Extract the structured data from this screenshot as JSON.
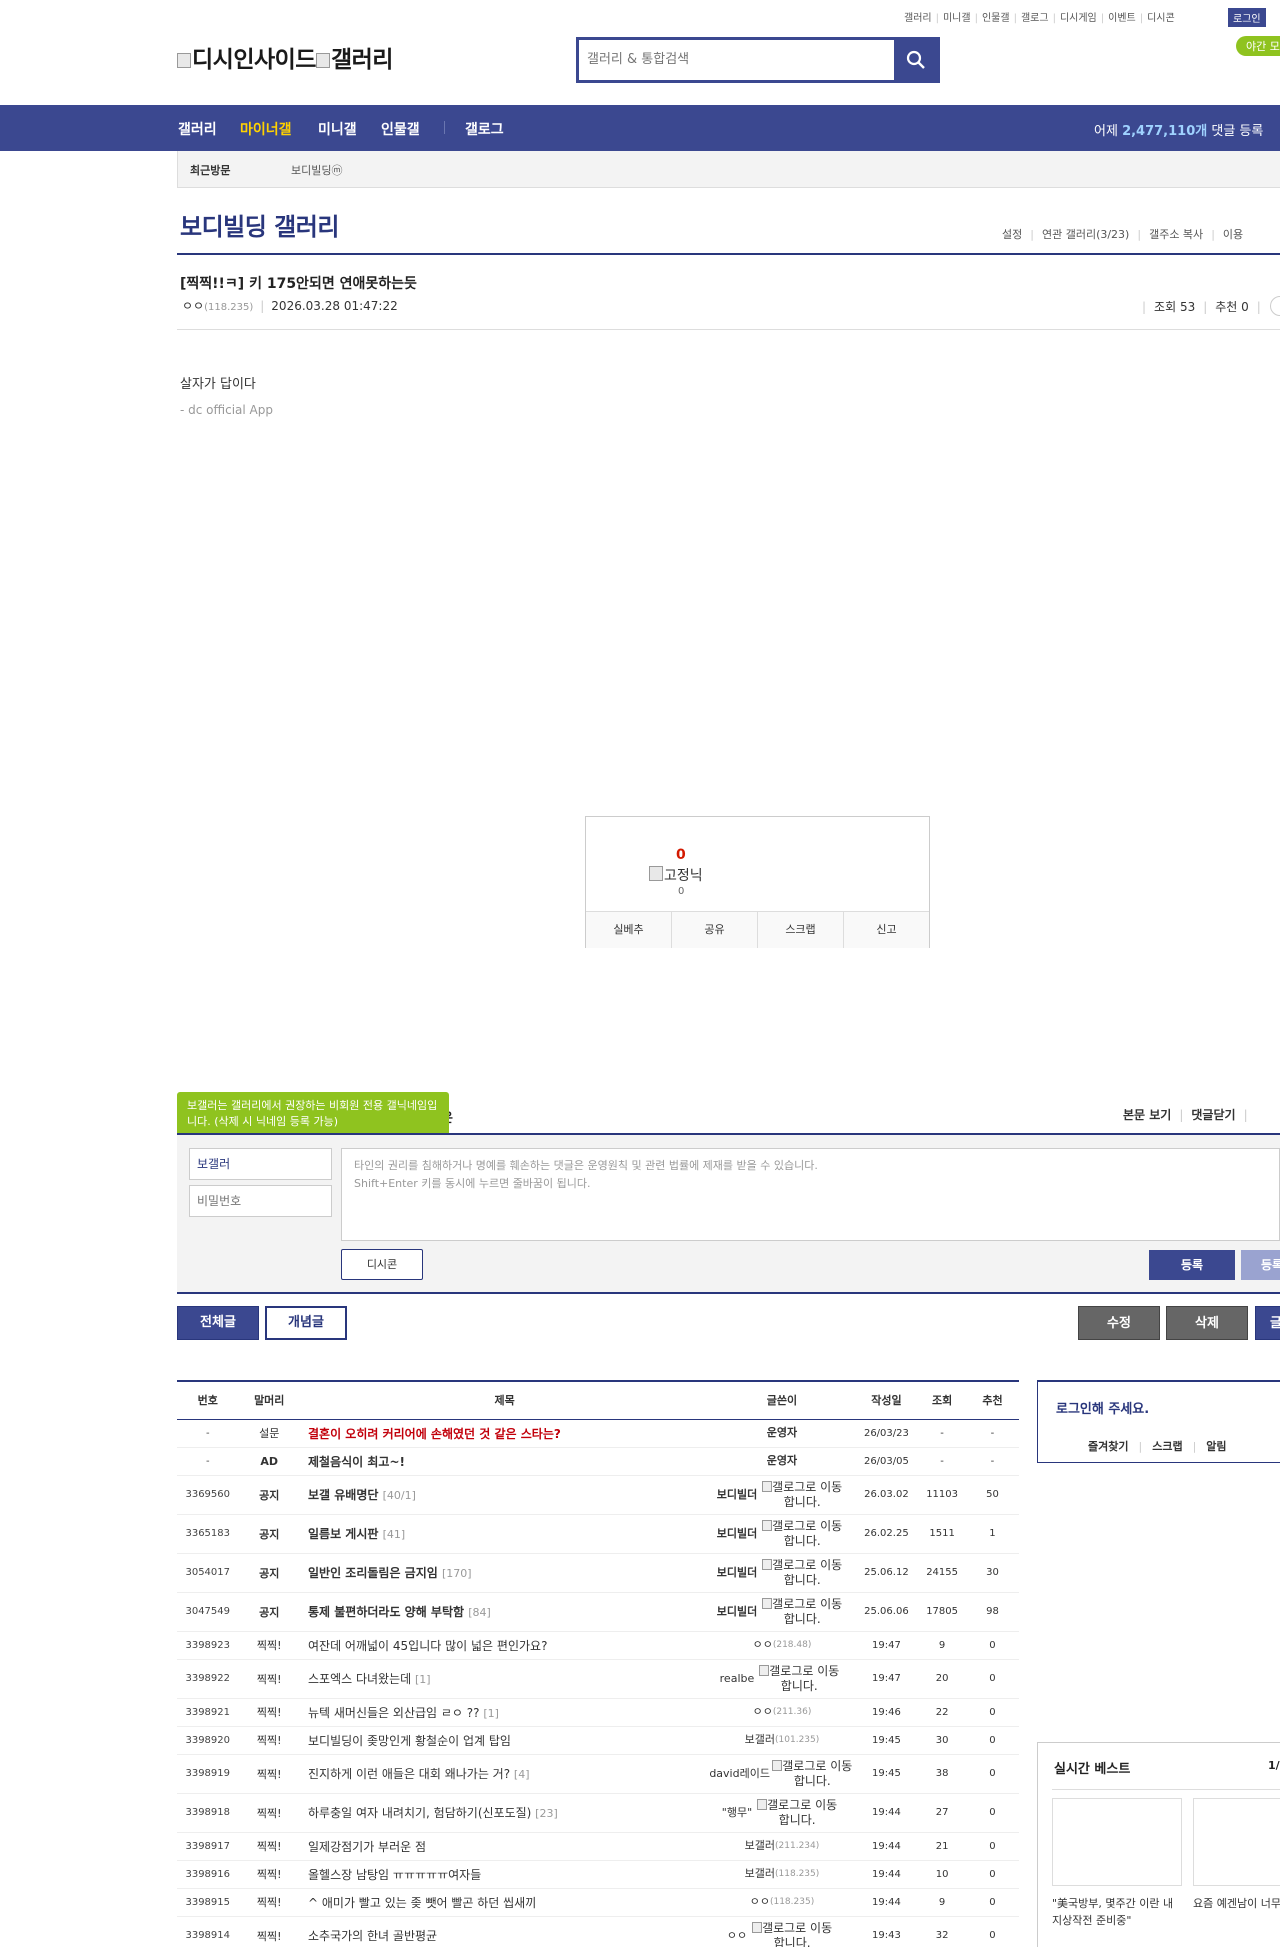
{
  "header": {
    "topnav": [
      "갤러리",
      "미니갤",
      "인물갤",
      "갤로그",
      "디시게임",
      "이벤트",
      "디시콘"
    ],
    "login": "로그인",
    "night_mode": "야간 모",
    "logo_text": "디시인사이드",
    "logo_sub": "갤러리",
    "search_placeholder": "갤러리 & 통합검색"
  },
  "gnb": {
    "items": [
      "갤러리",
      "마이너갤",
      "미니갤",
      "인물갤",
      "갤로그"
    ],
    "active_index": 1,
    "stat_prefix": "어제",
    "stat_num": "2,477,110개",
    "stat_suffix": "댓글 등록"
  },
  "recent": {
    "label": "최근방문",
    "item": "보디빌딩ⓜ"
  },
  "gallery": {
    "title": "보디빌딩 갤러리",
    "links": [
      "설정",
      "연관 갤러리(3/23)",
      "갤주소 복사",
      "이용"
    ]
  },
  "post": {
    "title": "[찍찍!!ㅋ] 키 175안되면 연애못하는듯",
    "writer": "ㅇㅇ",
    "ip": "(118.235)",
    "date": "2026.03.28 01:47:22",
    "views_label": "조회 53",
    "recommend_label": "추천 0",
    "body": "살자가 답이다",
    "signature": "- dc official App"
  },
  "recommend": {
    "count": "0",
    "fixed_nick_alt": "고정닉",
    "fixed_count": "0",
    "actions": [
      "실베추",
      "공유",
      "스크랩",
      "신고"
    ]
  },
  "comment": {
    "tooltip": "보갤러는 갤러리에서 권장하는 비회원 전용 갤닉네임입니다. (삭제 시 닉네임 등록 가능)",
    "tooltip_tail": "은",
    "view_body": "본문 보기",
    "close_comments": "댓글닫기",
    "nick_value": "보갤러",
    "password_placeholder": "비밀번호",
    "text_placeholder_1": "타인의 권리를 침해하거나 명예를 훼손하는 댓글은 운영원칙 및 관련 법률에 제재를 받을 수 있습니다.",
    "text_placeholder_2": "Shift+Enter 키를 동시에 누르면 줄바꿈이 됩니다.",
    "dccon": "디시콘",
    "submit": "등록",
    "submit2": "등록"
  },
  "buttons": {
    "tab_all": "전체글",
    "tab_concept": "개념글",
    "edit": "수정",
    "delete": "삭제",
    "write": "글"
  },
  "list": {
    "headers": [
      "번호",
      "말머리",
      "제목",
      "글쓴이",
      "작성일",
      "조회",
      "추천"
    ],
    "rows": [
      {
        "no": "-",
        "head": "설문",
        "subject": "결혼이 오히려 커리어에 손해였던 것 같은 스타는?",
        "reply": "",
        "writer": "운영자",
        "ip": "",
        "gallog": "",
        "date": "26/03/23",
        "views": "-",
        "rec": "-",
        "type": "survey"
      },
      {
        "no": "-",
        "head": "AD",
        "subject": "제철음식이 최고~!",
        "reply": "",
        "writer": "운영자",
        "ip": "",
        "gallog": "",
        "date": "26/03/05",
        "views": "-",
        "rec": "-",
        "type": "notice"
      },
      {
        "no": "3369560",
        "head": "공지",
        "subject": "보갤 유배명단",
        "reply": "[40/1]",
        "writer": "보디빌더",
        "ip": "",
        "gallog": "갤로그로 이동합니다.",
        "date": "26.03.02",
        "views": "11103",
        "rec": "50",
        "type": "notice"
      },
      {
        "no": "3365183",
        "head": "공지",
        "subject": "일름보 게시판",
        "reply": "[41]",
        "writer": "보디빌더",
        "ip": "",
        "gallog": "갤로그로 이동합니다.",
        "date": "26.02.25",
        "views": "1511",
        "rec": "1",
        "type": "notice"
      },
      {
        "no": "3054017",
        "head": "공지",
        "subject": "일반인 조리돌림은 금지임",
        "reply": "[170]",
        "writer": "보디빌더",
        "ip": "",
        "gallog": "갤로그로 이동합니다.",
        "date": "25.06.12",
        "views": "24155",
        "rec": "30",
        "type": "notice"
      },
      {
        "no": "3047549",
        "head": "공지",
        "subject": "통제 불편하더라도 양해 부탁함",
        "reply": "[84]",
        "writer": "보디빌더",
        "ip": "",
        "gallog": "갤로그로 이동합니다.",
        "date": "25.06.06",
        "views": "17805",
        "rec": "98",
        "type": "notice"
      },
      {
        "no": "3398923",
        "head": "찍찍!",
        "subject": "여잔데 어깨넓이 45입니다 많이 넓은 편인가요?",
        "reply": "",
        "writer": "ㅇㅇ",
        "ip": "(218.48)",
        "gallog": "",
        "date": "19:47",
        "views": "9",
        "rec": "0",
        "type": "normal"
      },
      {
        "no": "3398922",
        "head": "찍찍!",
        "subject": "스포엑스 다녀왔는데",
        "reply": "[1]",
        "writer": "realbe",
        "ip": "",
        "gallog": "갤로그로 이동합니다.",
        "date": "19:47",
        "views": "20",
        "rec": "0",
        "type": "normal"
      },
      {
        "no": "3398921",
        "head": "찍찍!",
        "subject": "뉴텍 새머신들은 외산급임 ㄹㅇ ??",
        "reply": "[1]",
        "writer": "ㅇㅇ",
        "ip": "(211.36)",
        "gallog": "",
        "date": "19:46",
        "views": "22",
        "rec": "0",
        "type": "normal"
      },
      {
        "no": "3398920",
        "head": "찍찍!",
        "subject": "보디빌딩이 좆망인게 황철순이 업계 탑임",
        "reply": "",
        "writer": "보갤러",
        "ip": "(101.235)",
        "gallog": "",
        "date": "19:45",
        "views": "30",
        "rec": "0",
        "type": "normal"
      },
      {
        "no": "3398919",
        "head": "찍찍!",
        "subject": "진지하게 이런 애들은 대회 왜나가는 거?",
        "reply": "[4]",
        "writer": "david레이드",
        "ip": "",
        "gallog": "갤로그로 이동합니다.",
        "date": "19:45",
        "views": "38",
        "rec": "0",
        "type": "normal"
      },
      {
        "no": "3398918",
        "head": "찍찍!",
        "subject": "하루충일 여자 내려치기, 험담하기(신포도질)",
        "reply": "[23]",
        "writer": "\"행무\"",
        "ip": "",
        "gallog": "갤로그로 이동합니다.",
        "date": "19:44",
        "views": "27",
        "rec": "0",
        "type": "normal"
      },
      {
        "no": "3398917",
        "head": "찍찍!",
        "subject": "일제강점기가 부러운 점",
        "reply": "",
        "writer": "보갤러",
        "ip": "(211.234)",
        "gallog": "",
        "date": "19:44",
        "views": "21",
        "rec": "0",
        "type": "normal"
      },
      {
        "no": "3398916",
        "head": "찍찍!",
        "subject": "올헬스장 남탕임 ㅠㅠㅠㅠㅠ여자들",
        "reply": "",
        "writer": "보갤러",
        "ip": "(118.235)",
        "gallog": "",
        "date": "19:44",
        "views": "10",
        "rec": "0",
        "type": "normal"
      },
      {
        "no": "3398915",
        "head": "찍찍!",
        "subject": "^ 애미가 빨고 있는 좆 뺏어 빨곤 하던 씹새끼",
        "reply": "",
        "writer": "ㅇㅇ",
        "ip": "(118.235)",
        "gallog": "",
        "date": "19:44",
        "views": "9",
        "rec": "0",
        "type": "normal"
      },
      {
        "no": "3398914",
        "head": "찍찍!",
        "subject": "소추국가의 한녀 골반평균",
        "reply": "",
        "writer": "ㅇㅇ",
        "ip": "",
        "gallog": "갤로그로 이동합니다.",
        "date": "19:43",
        "views": "32",
        "rec": "0",
        "type": "normal"
      }
    ]
  },
  "sidebar": {
    "login_title": "로그인해 주세요.",
    "login_links": [
      "즐겨찾기",
      "스크랩",
      "알림"
    ],
    "best_title": "실시간 베스트",
    "best_page": "1/",
    "best_items": [
      {
        "caption": "\"美국방부, 몇주간 이란 내 지상작전 준비중\""
      },
      {
        "caption": "요즘 예겐남이 너무 거같아"
      }
    ]
  },
  "colors": {
    "brand": "#3b4890",
    "brand_dark": "#29367c",
    "accent_yellow": "#ffd200",
    "tooltip_green": "#8fc31f",
    "survey_red": "#c2000b"
  }
}
